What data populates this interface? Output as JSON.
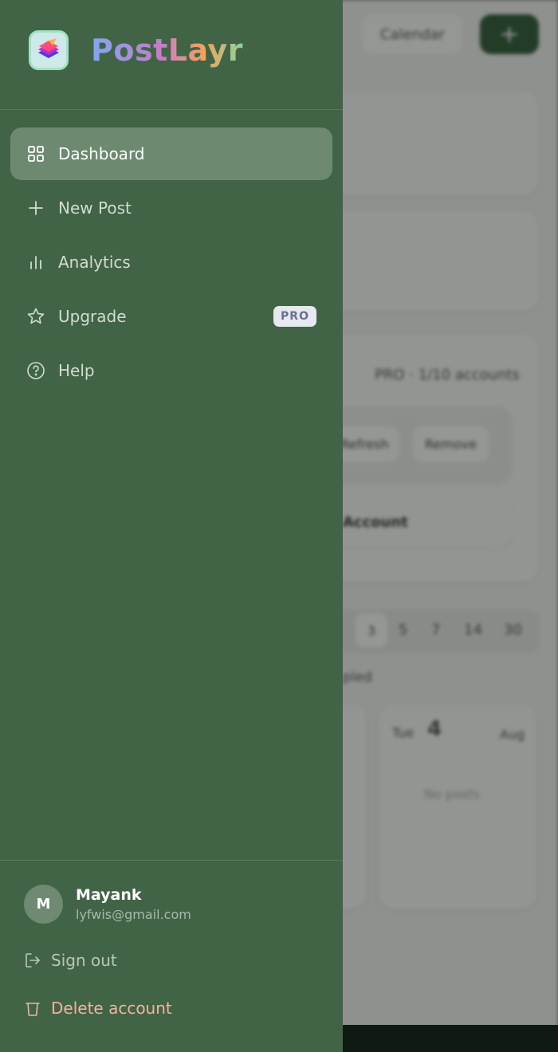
{
  "brand": {
    "name": "PostLayr"
  },
  "nav": {
    "items": [
      {
        "label": "Dashboard",
        "icon": "grid-icon",
        "active": true
      },
      {
        "label": "New Post",
        "icon": "plus-icon"
      },
      {
        "label": "Analytics",
        "icon": "bar-chart-icon"
      },
      {
        "label": "Upgrade",
        "icon": "star-icon",
        "badge": "PRO"
      },
      {
        "label": "Help",
        "icon": "help-circle-icon"
      }
    ]
  },
  "user": {
    "initial": "M",
    "name": "Mayank",
    "email": "lyfwis@gmail.com"
  },
  "actions": {
    "sign_out": "Sign out",
    "delete_account": "Delete account"
  },
  "background": {
    "calendar_button": "Calendar",
    "add_button": "+",
    "plan_text": "PRO · 1/10 accounts",
    "refresh_button": "Refresh",
    "remove_button": "Remove",
    "account_label": "Account",
    "day_options": [
      "3",
      "5",
      "7",
      "14",
      "30"
    ],
    "section_label": "pled",
    "tue_label": "Tue",
    "date_label": "4",
    "month_label": "Aug",
    "empty_text": "No posts"
  },
  "colors": {
    "drawer": "#416446",
    "active_item": "#6d8a70",
    "accent": "#2f5a3a",
    "danger_text": "#f0b4a3"
  }
}
